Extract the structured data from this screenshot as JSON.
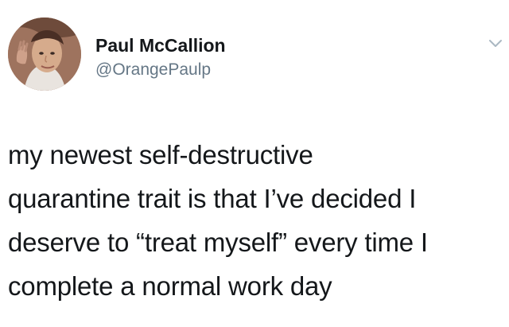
{
  "tweet": {
    "author": {
      "display_name": "Paul McCallion",
      "handle": "@OrangePaulp"
    },
    "text_lines": [
      "my newest self-destructive",
      "quarantine trait is that I’ve decided I",
      "deserve to “treat myself” every time I",
      "complete a normal work day"
    ],
    "icons": {
      "avatar": "profile-photo",
      "menu": "chevron-down-icon"
    },
    "colors": {
      "text": "#14171a",
      "secondary_text": "#657786",
      "background": "#ffffff"
    }
  }
}
